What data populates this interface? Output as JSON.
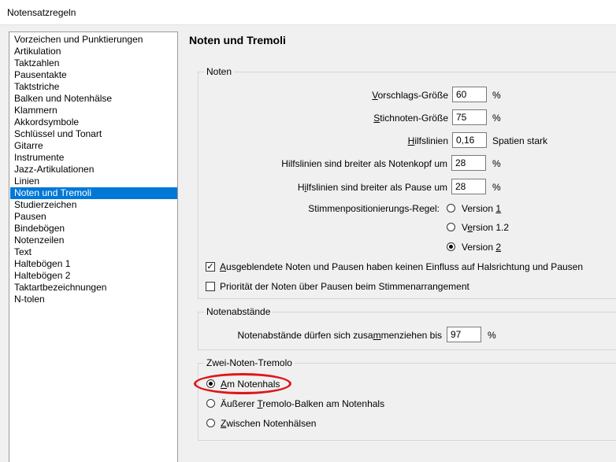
{
  "window": {
    "title": "Notensatzregeln"
  },
  "sidebar": {
    "items": [
      {
        "label": "Vorzeichen und Punktierungen"
      },
      {
        "label": "Artikulation"
      },
      {
        "label": "Taktzahlen"
      },
      {
        "label": "Pausentakte"
      },
      {
        "label": "Taktstriche"
      },
      {
        "label": "Balken und Notenhälse"
      },
      {
        "label": "Klammern"
      },
      {
        "label": "Akkordsymbole"
      },
      {
        "label": "Schlüssel und Tonart"
      },
      {
        "label": "Gitarre"
      },
      {
        "label": "Instrumente"
      },
      {
        "label": "Jazz-Artikulationen"
      },
      {
        "label": "Linien"
      },
      {
        "label": "Noten und Tremoli",
        "selected": true
      },
      {
        "label": "Studierzeichen"
      },
      {
        "label": "Pausen"
      },
      {
        "label": "Bindebögen"
      },
      {
        "label": "Notenzeilen"
      },
      {
        "label": "Text"
      },
      {
        "label": "Haltebögen 1"
      },
      {
        "label": "Haltebögen 2"
      },
      {
        "label": "Taktartbezeichnungen"
      },
      {
        "label": "N-tolen"
      }
    ]
  },
  "main": {
    "heading": "Noten und Tremoli",
    "noten": {
      "title": "Noten",
      "grace_label_u": "V",
      "grace_label_rest": "orschlags-Größe",
      "grace_value": "60",
      "grace_unit": "%",
      "cue_label_u": "S",
      "cue_label_rest": "tichnoten-Größe",
      "cue_value": "75",
      "cue_unit": "%",
      "ledger_label_u": "H",
      "ledger_label_rest": "ilfslinien",
      "ledger_value": "0,16",
      "ledger_unit": "Spatien stark",
      "ledger_head_label": "Hilfslinien sind breiter als Notenkopf um",
      "ledger_head_value": "28",
      "ledger_head_unit": "%",
      "ledger_rest_label_pre": "H",
      "ledger_rest_label_u": "i",
      "ledger_rest_label_rest": "lfslinien sind breiter als Pause um",
      "ledger_rest_value": "28",
      "ledger_rest_unit": "%",
      "voice_rule_label": "Stimmenpositionierungs-Regel:",
      "voice_v1_pre": "Version ",
      "voice_v1_u": "1",
      "voice_v12_pre": "V",
      "voice_v12_u": "e",
      "voice_v12_rest": "rsion 1.2",
      "voice_v2_pre": "Version ",
      "voice_v2_u": "2",
      "voice_selected": "Version 2",
      "hidden_u": "A",
      "hidden_rest": "usgeblendete Noten und Pausen haben keinen Einfluss auf Halsrichtung und Pausen",
      "hidden_checked": true,
      "priority_label": "Priorität der Noten über Pausen beim Stimmenarrangement",
      "priority_checked": false
    },
    "spacing": {
      "title": "Notenabstände",
      "label_pre": "Notenabstände dürfen sich zusa",
      "label_u": "m",
      "label_rest": "menziehen bis",
      "value": "97",
      "unit": "%"
    },
    "tremolo": {
      "title": "Zwei-Noten-Tremolo",
      "opt1_u": "A",
      "opt1_rest": "m Notenhals",
      "opt2_pre": "Äußerer ",
      "opt2_u": "T",
      "opt2_rest": "remolo-Balken am Notenhals",
      "opt3_u": "Z",
      "opt3_rest": "wischen Notenhälsen",
      "selected": "Am Notenhals"
    }
  },
  "colors": {
    "selection": "#0078d7",
    "highlight_circle": "#e0161b"
  }
}
